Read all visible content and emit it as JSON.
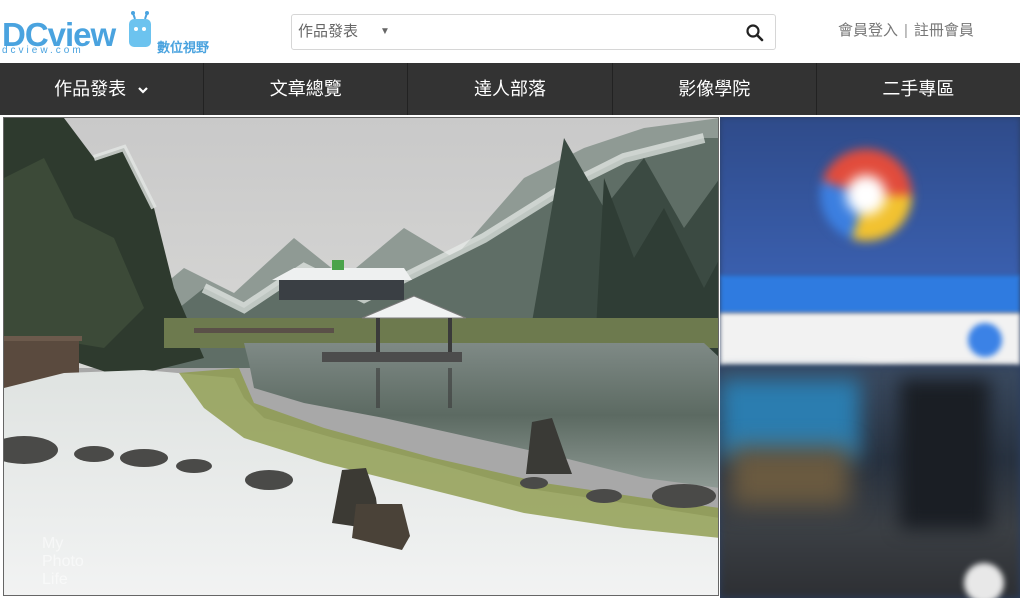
{
  "header": {
    "logo": {
      "word": "DCview",
      "sub": "dcview.com",
      "cn": "數位視野"
    },
    "search": {
      "category": "作品發表",
      "placeholder": "",
      "value": ""
    },
    "account": {
      "login": "會員登入",
      "register": "註冊會員",
      "separator": "|"
    }
  },
  "nav": {
    "items": [
      {
        "label": "作品發表",
        "has_dropdown": true
      },
      {
        "label": "文章總覽"
      },
      {
        "label": "達人部落"
      },
      {
        "label": "影像學院"
      },
      {
        "label": "二手專區"
      }
    ]
  },
  "main_photo": {
    "subject": "snowy pond with pavilion and forest",
    "watermark": "My Photo Life"
  },
  "icons": {
    "search": "search-icon",
    "dropdown": "chevron-down-icon",
    "logo_mascot": "robot-icon"
  },
  "colors": {
    "brand": "#4aa3df",
    "nav_bg": "#333333",
    "nav_text": "#ffffff",
    "account_text": "#777777"
  }
}
